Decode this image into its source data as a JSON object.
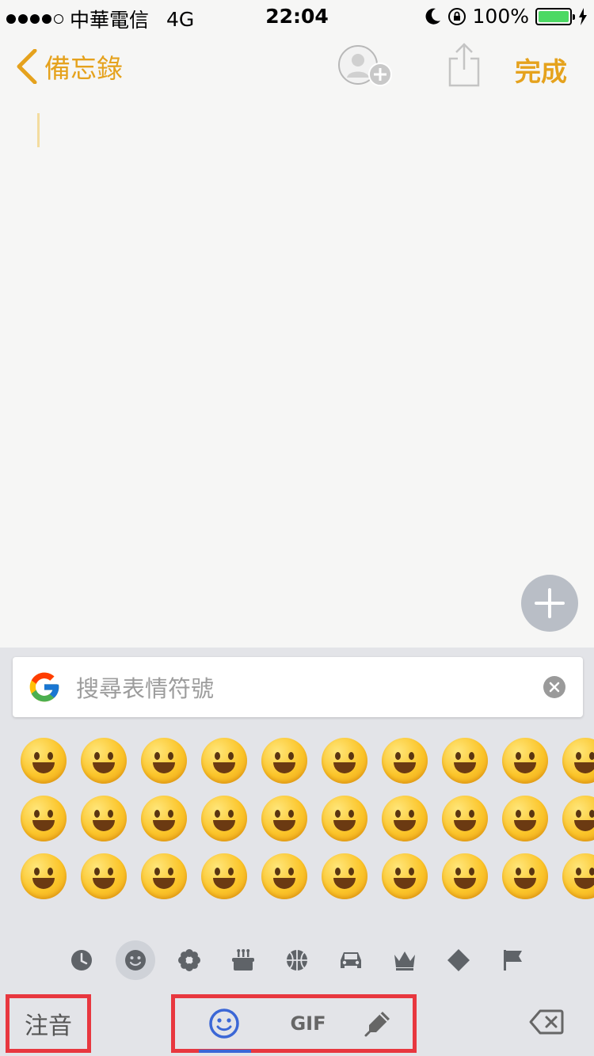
{
  "status_bar": {
    "carrier": "中華電信",
    "network": "4G",
    "time": "22:04",
    "battery_percent": "100%",
    "battery_level": 1.0,
    "battery_color": "#4cd964"
  },
  "nav": {
    "back_label": "備忘錄",
    "done_label": "完成",
    "accent_color": "#e5a21d"
  },
  "keyboard": {
    "search_placeholder": "搜尋表情符號",
    "lang_label": "注音",
    "gif_label": "GIF",
    "categories": [
      "recent-clock-icon",
      "smiley-icon",
      "flower-icon",
      "food-cake-icon",
      "sports-ball-icon",
      "car-icon",
      "crown-icon",
      "diamond-icon",
      "flag-icon"
    ],
    "active_category": "smiley-icon"
  }
}
